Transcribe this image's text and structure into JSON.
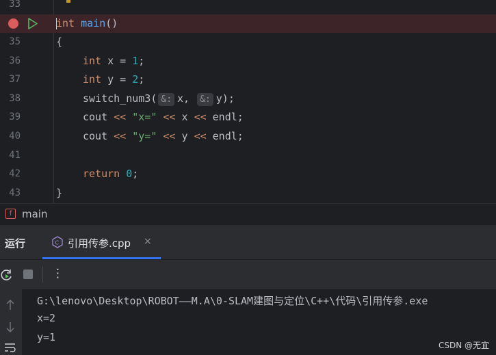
{
  "editor": {
    "lines": [
      {
        "num": "33",
        "code": ""
      },
      {
        "num": "",
        "kw": "int",
        "fn": "main",
        "rest": "()"
      },
      {
        "num": "35",
        "code": "{"
      },
      {
        "num": "36",
        "kw": "int",
        "pre": " x = ",
        "val": "1",
        "post": ";"
      },
      {
        "num": "37",
        "kw": "int",
        "pre": " y = ",
        "val": "2",
        "post": ";"
      },
      {
        "num": "38",
        "a": "switch_num3(",
        "hint1": "&:",
        "b": "x,",
        "hint2": "&:",
        "c": "y);"
      },
      {
        "num": "39",
        "a": "cout ",
        "op1": "<<",
        "s": " \"x=\" ",
        "op2": "<<",
        "b": " x ",
        "op3": "<<",
        "c": " endl;"
      },
      {
        "num": "40",
        "a": "cout ",
        "op1": "<<",
        "s": " \"y=\" ",
        "op2": "<<",
        "b": " y ",
        "op3": "<<",
        "c": " endl;"
      },
      {
        "num": "41",
        "code": ""
      },
      {
        "num": "42",
        "kw": "return",
        "val": "0",
        "post": ";"
      },
      {
        "num": "43",
        "code": "}"
      }
    ]
  },
  "breadcrumb": {
    "badge": "f",
    "label": "main"
  },
  "run_panel": {
    "title": "运行",
    "tab_label": "引用传参.cpp",
    "tab_close": "×",
    "more": "⋮"
  },
  "console": {
    "lines": [
      "G:\\lenovo\\Desktop\\ROBOT——M.A\\0-SLAM建图与定位\\C++\\代码\\引用传参.exe",
      "x=2",
      "y=1"
    ]
  },
  "watermark": "CSDN @无宜",
  "colors": {
    "accent": "#3574f0",
    "breakpoint": "#db5c5c",
    "run": "#5fb865"
  }
}
